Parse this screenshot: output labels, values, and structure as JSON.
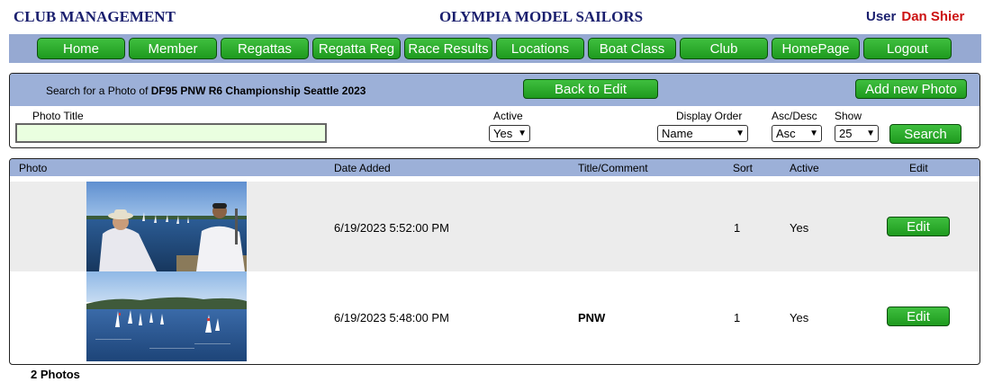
{
  "header": {
    "left_title": "CLUB MANAGEMENT",
    "center_title": "OLYMPIA MODEL SAILORS",
    "user_label": "User",
    "user_name": "Dan Shier"
  },
  "nav": {
    "items": [
      "Home",
      "Member",
      "Regattas",
      "Regatta Reg",
      "Race Results",
      "Locations",
      "Boat Class",
      "Club",
      "HomePage",
      "Logout"
    ]
  },
  "search": {
    "prefix": "Search for a Photo of",
    "regatta": "DF95 PNW R6 Championship Seattle 2023",
    "back_label": "Back to Edit",
    "add_label": "Add new Photo",
    "photo_title_label": "Photo Title",
    "photo_title_value": "",
    "active_label": "Active",
    "active_value": "Yes",
    "display_order_label": "Display Order",
    "display_order_value": "Name",
    "ascdesc_label": "Asc/Desc",
    "ascdesc_value": "Asc",
    "show_label": "Show",
    "show_value": "25",
    "search_label": "Search"
  },
  "table": {
    "columns": [
      "Photo",
      "Date Added",
      "Title/Comment",
      "Sort",
      "Active",
      "Edit"
    ],
    "rows": [
      {
        "date": "6/19/2023 5:52:00 PM",
        "title": "",
        "sort": "1",
        "active": "Yes",
        "edit": "Edit"
      },
      {
        "date": "6/19/2023 5:48:00 PM",
        "title": "PNW",
        "sort": "1",
        "active": "Yes",
        "edit": "Edit"
      }
    ]
  },
  "footer": {
    "count": "2 Photos"
  },
  "colors": {
    "navy": "#1a1f6e",
    "user_red": "#cc1111",
    "nav_bg": "#96a9d2",
    "button_green": "#2aa82a",
    "row_alt": "#ececec"
  }
}
